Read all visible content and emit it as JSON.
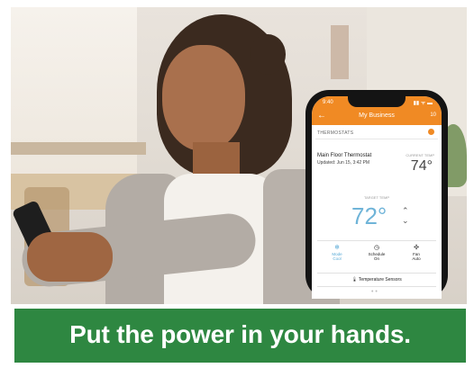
{
  "phone": {
    "status": {
      "time": "9:40",
      "icons": "▮▮ ᯤ ▬"
    },
    "appbar": {
      "title": "My Business",
      "right": "10"
    },
    "section_title": "THERMOSTATS",
    "device_name": "Main Floor Thermostat",
    "updated": "Updated: Jun 15, 3:42 PM",
    "current_label": "CURRENT TEMP",
    "current_temp": "74°",
    "target_label": "TARGET TEMP",
    "target_temp": "72°",
    "modes": [
      {
        "icon": "❄",
        "line1": "Mode",
        "line2": "Cool"
      },
      {
        "icon": "◷",
        "line1": "Schedule",
        "line2": "On"
      },
      {
        "icon": "✣",
        "line1": "Fan",
        "line2": "Auto"
      }
    ],
    "sensors_label": "Temperature Sensors",
    "page_dots": "• •"
  },
  "banner": {
    "text": "Put the power in your hands."
  },
  "colors": {
    "accent": "#f08a24",
    "banner": "#2e8741",
    "target": "#6fb4d8"
  }
}
